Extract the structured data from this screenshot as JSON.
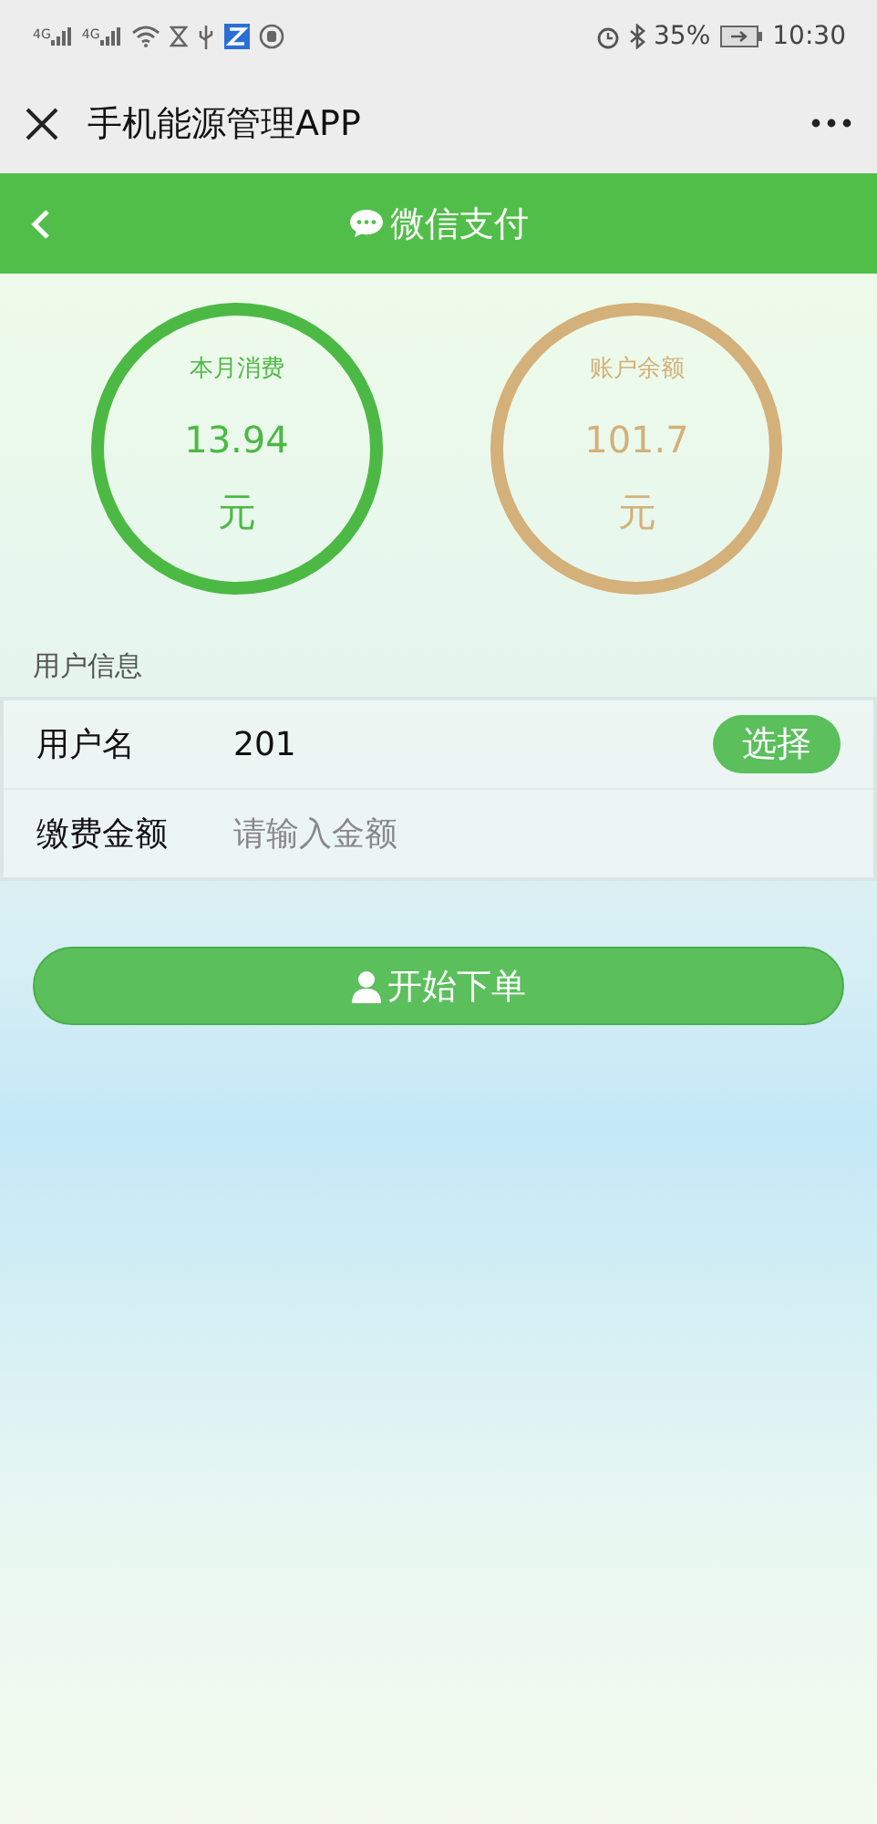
{
  "status_bar": {
    "signals": [
      "4G",
      "4G"
    ],
    "battery_percent": "35%",
    "time": "10:30"
  },
  "nav_bar": {
    "title": "手机能源管理APP"
  },
  "header": {
    "title": "微信支付"
  },
  "summary": [
    {
      "label": "本月消费",
      "value": "13.94",
      "unit": "元",
      "color": "#4cb944"
    },
    {
      "label": "账户余额",
      "value": "101.7",
      "unit": "元",
      "color": "#d4b07a"
    }
  ],
  "section_title": "用户信息",
  "form": {
    "username_label": "用户名",
    "username_value": "201",
    "select_button": "选择",
    "amount_label": "缴费金额",
    "amount_placeholder": "请输入金额"
  },
  "submit_button": "开始下单"
}
